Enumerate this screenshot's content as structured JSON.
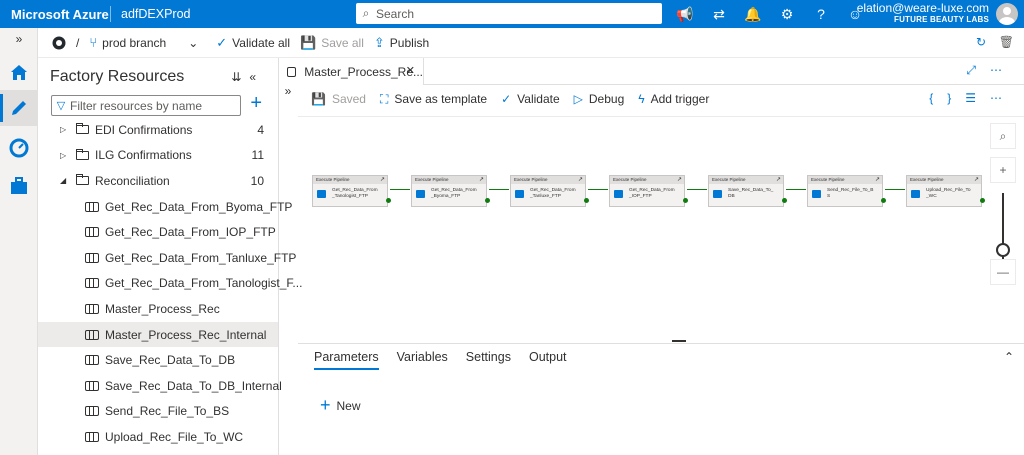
{
  "topbar": {
    "brand": "Microsoft Azure",
    "factory": "adfDEXProd",
    "search_placeholder": "Search",
    "user_email": "elation@weare-luxe.com",
    "user_org": "FUTURE BEAUTY LABS"
  },
  "commandbar": {
    "branch": "prod branch",
    "validate_all": "Validate all",
    "save_all": "Save all",
    "publish": "Publish"
  },
  "panel": {
    "title": "Factory Resources",
    "filter_placeholder": "Filter resources by name",
    "folders": [
      {
        "label": "EDI Confirmations",
        "count": "4"
      },
      {
        "label": "ILG Confirmations",
        "count": "11"
      },
      {
        "label": "Reconciliation",
        "count": "10"
      }
    ],
    "pipelines": [
      "Get_Rec_Data_From_Byoma_FTP",
      "Get_Rec_Data_From_IOP_FTP",
      "Get_Rec_Data_From_Tanluxe_FTP",
      "Get_Rec_Data_From_Tanologist_F...",
      "Master_Process_Rec",
      "Master_Process_Rec_Internal",
      "Save_Rec_Data_To_DB",
      "Save_Rec_Data_To_DB_Internal",
      "Send_Rec_File_To_BS",
      "Upload_Rec_File_To_WC"
    ]
  },
  "editor": {
    "tab_title": "Master_Process_Re...",
    "toolbar": {
      "saved": "Saved",
      "save_as_template": "Save as template",
      "validate": "Validate",
      "debug": "Debug",
      "add_trigger": "Add trigger"
    },
    "activities": [
      {
        "type": "Execute Pipeline",
        "name_line1": "Get_Rec_Data_From",
        "name_line2": "_Tanologist_FTP"
      },
      {
        "type": "Execute Pipeline",
        "name_line1": "Get_Rec_Data_From",
        "name_line2": "_Byoma_FTP"
      },
      {
        "type": "Execute Pipeline",
        "name_line1": "Get_Rec_Data_From",
        "name_line2": "_Tanluxe_FTP"
      },
      {
        "type": "Execute Pipeline",
        "name_line1": "Get_Rec_Data_From",
        "name_line2": "_IOP_FTP"
      },
      {
        "type": "Execute Pipeline",
        "name_line1": "Save_Rec_Data_To_",
        "name_line2": "DB"
      },
      {
        "type": "Execute Pipeline",
        "name_line1": "Send_Rec_File_To_B",
        "name_line2": "S"
      },
      {
        "type": "Execute Pipeline",
        "name_line1": "Upload_Rec_File_To",
        "name_line2": "_WC"
      }
    ],
    "bottom_tabs": [
      "Parameters",
      "Variables",
      "Settings",
      "Output"
    ],
    "new_label": "New"
  }
}
